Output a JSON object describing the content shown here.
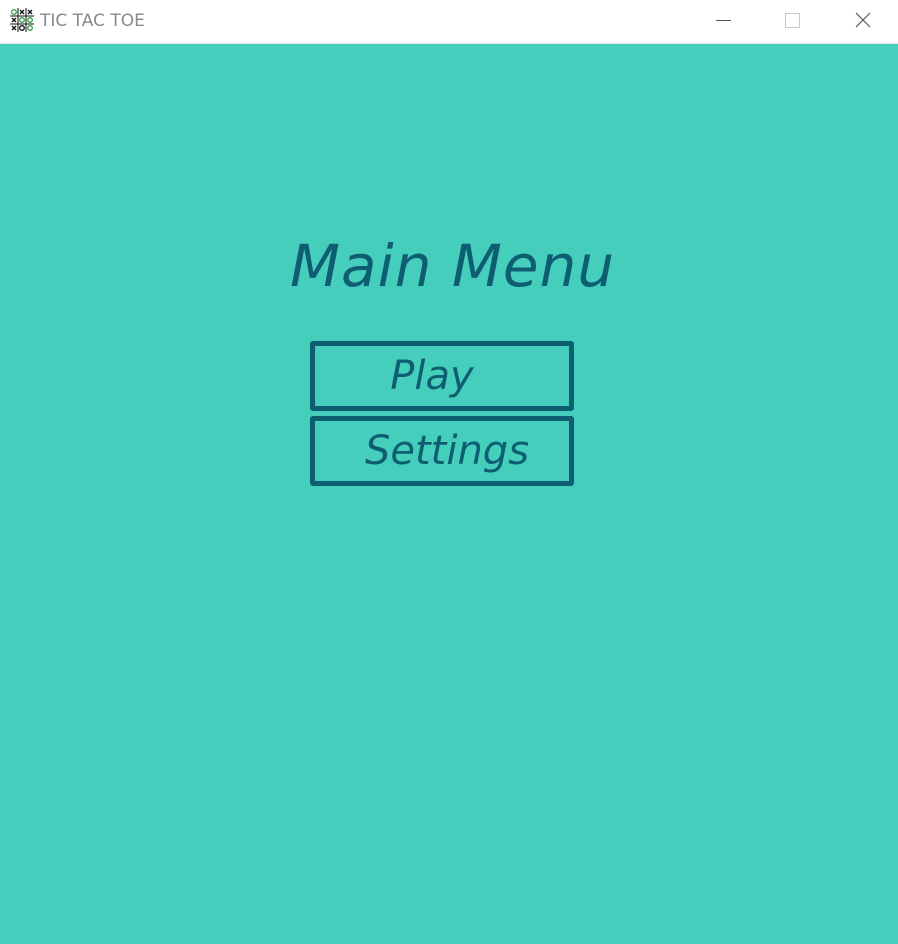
{
  "window": {
    "title": "TIC TAC TOE",
    "app_icon": "tic-tac-toe-grid-icon",
    "controls": {
      "minimize": "minimize-icon",
      "maximize": "maximize-icon",
      "close": "close-icon"
    }
  },
  "main_menu": {
    "title": "Main Menu",
    "buttons": {
      "play": "Play",
      "settings": "Settings"
    }
  },
  "colors": {
    "background": "#46cebd",
    "accent": "#0e5e72",
    "titlebar": "#ffffff",
    "titlebar_text": "#8a8a8a"
  }
}
